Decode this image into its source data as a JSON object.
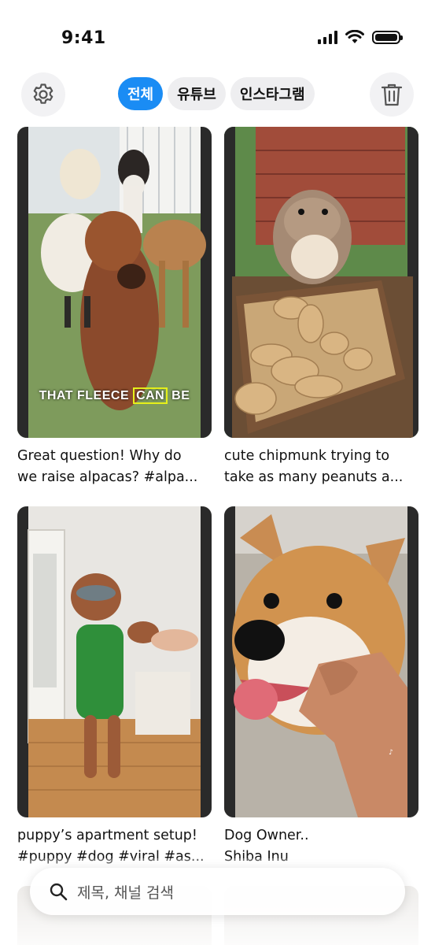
{
  "status_bar": {
    "time": "9:41"
  },
  "tabs": [
    {
      "label": "전체",
      "active": true
    },
    {
      "label": "유튜브",
      "active": false
    },
    {
      "label": "인스타그램",
      "active": false
    }
  ],
  "icons": {
    "settings": "gear-icon",
    "delete": "trash-icon",
    "search": "search-icon"
  },
  "colors": {
    "accent": "#1a8cf4"
  },
  "videos": [
    {
      "caption_line1": "Great question! Why do",
      "caption_line2": "we raise alpacas? #alpa...",
      "overlay_pre": "THAT FLEECE ",
      "overlay_hl": "CAN",
      "overlay_post": " BE"
    },
    {
      "caption_line1": "cute chipmunk trying to",
      "caption_line2": "take as many peanuts a..."
    },
    {
      "caption_line1": "puppy’s apartment setup!",
      "caption_line2": "#puppy #dog #viral #as..."
    },
    {
      "caption_line1": "Dog Owner..",
      "caption_line2": "Shiba Inu"
    }
  ],
  "search": {
    "placeholder": "제목, 채널 검색"
  }
}
